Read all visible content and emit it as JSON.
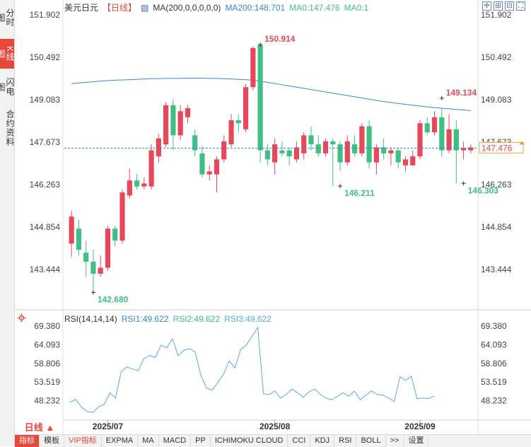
{
  "side_tabs": [
    {
      "label": "分时图",
      "active": false
    },
    {
      "label": "K线图",
      "active": true
    },
    {
      "label": "闪电图",
      "active": false
    },
    {
      "label": "合约资料",
      "active": false
    }
  ],
  "header": {
    "symbol": "美元日元",
    "period": "【日线】",
    "ma_label": "MA(200,0,0,0,0,0)",
    "ma200": "MA200:148.701",
    "ma0a": "MA0:147.476",
    "ma0b": "MA0:1"
  },
  "tools": [
    {
      "icon": "crosshair-icon",
      "glyph": "✛"
    },
    {
      "icon": "zoom-in-icon",
      "glyph": "⊞"
    },
    {
      "icon": "zoom-out-icon",
      "glyph": "⊟"
    },
    {
      "icon": "fullscreen-icon",
      "glyph": "⛶"
    }
  ],
  "colors": {
    "up": "#e8475a",
    "down": "#3fbf84",
    "ma200": "#3a86d4",
    "rsi": "#5aa9e6",
    "price_line": "#2f8fd6",
    "current_price_bg": "#ffffff",
    "current_price_border": "#f0a030"
  },
  "chart_data": {
    "type": "candlestick",
    "price_axis_ticks": [
      "151.902",
      "150.492",
      "149.083",
      "147.673",
      "146.263",
      "144.854",
      "143.444"
    ],
    "price_range": [
      142.1,
      152.3
    ],
    "current_price": "147.476",
    "annotations": [
      {
        "label": "150.914",
        "index": 26,
        "value": 150.914,
        "kind": "high"
      },
      {
        "label": "146.211",
        "index": 37,
        "value": 146.211,
        "kind": "low"
      },
      {
        "label": "149.134",
        "index": 51,
        "value": 149.134,
        "kind": "high"
      },
      {
        "label": "146.303",
        "index": 54,
        "value": 146.303,
        "kind": "low"
      },
      {
        "label": "142.680",
        "index": 3,
        "value": 142.68,
        "kind": "low"
      }
    ],
    "x_ticks": [
      {
        "label": "2025/07",
        "index": 5
      },
      {
        "label": "2025/08",
        "index": 28
      },
      {
        "label": "2025/09",
        "index": 48
      }
    ],
    "candles": [
      {
        "o": 144.3,
        "h": 145.4,
        "l": 143.85,
        "c": 145.2
      },
      {
        "o": 144.8,
        "h": 145.1,
        "l": 143.9,
        "c": 144.1
      },
      {
        "o": 144.0,
        "h": 144.4,
        "l": 143.2,
        "c": 143.7
      },
      {
        "o": 143.7,
        "h": 144.1,
        "l": 142.68,
        "c": 143.3
      },
      {
        "o": 143.3,
        "h": 143.9,
        "l": 143.2,
        "c": 143.5
      },
      {
        "o": 143.5,
        "h": 144.9,
        "l": 143.4,
        "c": 144.8
      },
      {
        "o": 144.8,
        "h": 144.9,
        "l": 144.2,
        "c": 144.4
      },
      {
        "o": 144.4,
        "h": 146.1,
        "l": 144.3,
        "c": 146.0
      },
      {
        "o": 145.9,
        "h": 146.8,
        "l": 145.8,
        "c": 146.4
      },
      {
        "o": 146.4,
        "h": 146.6,
        "l": 146.1,
        "c": 146.2
      },
      {
        "o": 146.2,
        "h": 146.5,
        "l": 146.1,
        "c": 146.3
      },
      {
        "o": 146.2,
        "h": 147.6,
        "l": 146.1,
        "c": 147.4
      },
      {
        "o": 147.2,
        "h": 147.95,
        "l": 147.0,
        "c": 147.8
      },
      {
        "o": 147.6,
        "h": 149.0,
        "l": 147.5,
        "c": 148.9
      },
      {
        "o": 148.9,
        "h": 149.1,
        "l": 147.4,
        "c": 147.9
      },
      {
        "o": 147.9,
        "h": 148.9,
        "l": 147.75,
        "c": 148.7
      },
      {
        "o": 148.5,
        "h": 148.9,
        "l": 148.3,
        "c": 148.8
      },
      {
        "o": 147.9,
        "h": 148.1,
        "l": 147.2,
        "c": 147.4
      },
      {
        "o": 147.3,
        "h": 147.55,
        "l": 146.5,
        "c": 146.6
      },
      {
        "o": 146.6,
        "h": 146.9,
        "l": 146.4,
        "c": 146.7
      },
      {
        "o": 146.6,
        "h": 147.2,
        "l": 146.0,
        "c": 147.1
      },
      {
        "o": 147.1,
        "h": 147.9,
        "l": 147.0,
        "c": 147.7
      },
      {
        "o": 147.6,
        "h": 148.6,
        "l": 147.5,
        "c": 148.4
      },
      {
        "o": 148.4,
        "h": 148.6,
        "l": 148.0,
        "c": 148.3
      },
      {
        "o": 148.1,
        "h": 149.6,
        "l": 148.0,
        "c": 149.5
      },
      {
        "o": 149.5,
        "h": 150.85,
        "l": 149.4,
        "c": 150.8
      },
      {
        "o": 150.9,
        "h": 150.914,
        "l": 147.0,
        "c": 147.4
      },
      {
        "o": 147.4,
        "h": 147.6,
        "l": 146.9,
        "c": 147.1
      },
      {
        "o": 147.0,
        "h": 147.8,
        "l": 146.6,
        "c": 147.6
      },
      {
        "o": 147.4,
        "h": 147.7,
        "l": 147.2,
        "c": 147.3
      },
      {
        "o": 147.4,
        "h": 147.5,
        "l": 146.9,
        "c": 147.2
      },
      {
        "o": 147.1,
        "h": 147.7,
        "l": 147.0,
        "c": 147.5
      },
      {
        "o": 147.3,
        "h": 148.0,
        "l": 147.1,
        "c": 147.9
      },
      {
        "o": 147.9,
        "h": 148.2,
        "l": 147.4,
        "c": 147.6
      },
      {
        "o": 147.6,
        "h": 147.9,
        "l": 147.2,
        "c": 147.3
      },
      {
        "o": 147.3,
        "h": 147.8,
        "l": 147.2,
        "c": 147.7
      },
      {
        "o": 147.7,
        "h": 147.8,
        "l": 146.211,
        "c": 147.6
      },
      {
        "o": 147.6,
        "h": 147.7,
        "l": 146.7,
        "c": 147.0
      },
      {
        "o": 147.0,
        "h": 147.9,
        "l": 146.9,
        "c": 147.7
      },
      {
        "o": 147.6,
        "h": 147.9,
        "l": 147.2,
        "c": 147.3
      },
      {
        "o": 147.3,
        "h": 148.3,
        "l": 147.2,
        "c": 148.2
      },
      {
        "o": 148.2,
        "h": 148.4,
        "l": 146.8,
        "c": 147.0
      },
      {
        "o": 147.0,
        "h": 147.6,
        "l": 146.6,
        "c": 147.5
      },
      {
        "o": 147.5,
        "h": 147.8,
        "l": 147.1,
        "c": 147.3
      },
      {
        "o": 147.3,
        "h": 147.5,
        "l": 146.9,
        "c": 147.4
      },
      {
        "o": 147.4,
        "h": 147.5,
        "l": 146.8,
        "c": 147.0
      },
      {
        "o": 146.9,
        "h": 147.2,
        "l": 146.7,
        "c": 147.1
      },
      {
        "o": 146.9,
        "h": 147.4,
        "l": 146.9,
        "c": 147.2
      },
      {
        "o": 147.2,
        "h": 148.4,
        "l": 147.1,
        "c": 148.3
      },
      {
        "o": 148.3,
        "h": 148.5,
        "l": 147.9,
        "c": 148.0
      },
      {
        "o": 148.0,
        "h": 148.7,
        "l": 147.9,
        "c": 148.5
      },
      {
        "o": 148.5,
        "h": 148.8,
        "l": 147.2,
        "c": 147.4
      },
      {
        "o": 147.4,
        "h": 148.6,
        "l": 147.3,
        "c": 148.1
      },
      {
        "o": 148.1,
        "h": 148.4,
        "l": 146.303,
        "c": 147.4
      },
      {
        "o": 147.4,
        "h": 147.7,
        "l": 147.1,
        "c": 147.48
      },
      {
        "o": 147.4,
        "h": 147.6,
        "l": 147.3,
        "c": 147.5
      }
    ],
    "ma200": [
      149.62,
      149.64,
      149.66,
      149.68,
      149.7,
      149.72,
      149.73,
      149.74,
      149.75,
      149.76,
      149.77,
      149.78,
      149.78,
      149.79,
      149.79,
      149.79,
      149.8,
      149.8,
      149.8,
      149.79,
      149.79,
      149.78,
      149.77,
      149.76,
      149.75,
      149.73,
      149.7,
      149.66,
      149.62,
      149.58,
      149.54,
      149.5,
      149.46,
      149.42,
      149.38,
      149.34,
      149.3,
      149.26,
      149.22,
      149.18,
      149.14,
      149.1,
      149.06,
      149.02,
      148.99,
      148.96,
      148.93,
      148.9,
      148.87,
      148.84,
      148.82,
      148.8,
      148.78,
      148.76,
      148.74,
      148.72
    ],
    "rsi": {
      "label": "RSI(14,14,14)",
      "rsi1": "RSI1:49.622",
      "rsi2": "RSI2:49.622",
      "rsi3": "RSI3:49.622",
      "axis_ticks": [
        "69.380",
        "64.093",
        "58.806",
        "53.519",
        "48.232"
      ],
      "range": [
        44.0,
        70.0
      ],
      "values": [
        47.8,
        48.6,
        46.5,
        45.2,
        44.9,
        46.5,
        47.2,
        50.5,
        49.0,
        56.5,
        57.8,
        57.2,
        56.8,
        60.2,
        61.0,
        60.5,
        64.0,
        63.2,
        65.8,
        61.0,
        62.5,
        63.0,
        62.0,
        55.5,
        51.8,
        51.2,
        53.5,
        55.8,
        59.5,
        57.5,
        62.8,
        64.0,
        66.5,
        69.0,
        50.2,
        50.0,
        51.0,
        49.0,
        50.0,
        51.5,
        50.5,
        49.2,
        50.8,
        51.5,
        50.0,
        49.0,
        48.5,
        49.5,
        50.5,
        49.5,
        51.0,
        48.5,
        49.8,
        51.0,
        50.0,
        49.8,
        49.0,
        48.0,
        55.0,
        54.0,
        55.2,
        48.8,
        49.0,
        48.8,
        49.6
      ]
    }
  },
  "rsi_gear_icon": "gear-icon",
  "period_button": {
    "label": "日线",
    "icon": "caret-up-icon"
  },
  "bottom_tabs": [
    {
      "label": "指标",
      "active": true
    },
    {
      "label": "模板",
      "active": false
    },
    {
      "label": "VIP指标",
      "active": false,
      "vip": true
    },
    {
      "label": "EXPMA",
      "active": false
    },
    {
      "label": "MA",
      "active": false
    },
    {
      "label": "MACD",
      "active": false
    },
    {
      "label": "PP",
      "active": false
    },
    {
      "label": "ICHIMOKU CLOUD",
      "active": false
    },
    {
      "label": "CCI",
      "active": false
    },
    {
      "label": "KDJ",
      "active": false
    },
    {
      "label": "RSI",
      "active": false
    },
    {
      "label": "BOLL",
      "active": false
    },
    {
      "label": ">>",
      "active": false
    },
    {
      "label": "设置",
      "active": false
    }
  ]
}
